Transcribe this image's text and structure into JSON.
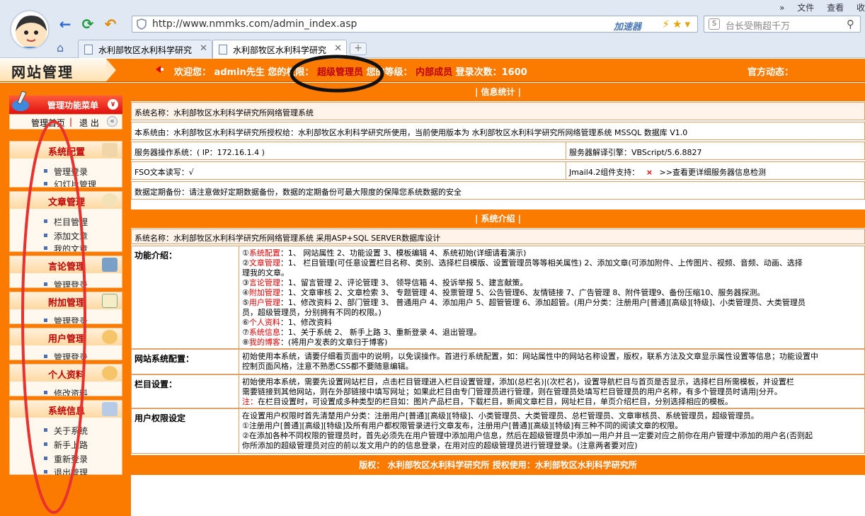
{
  "browser": {
    "toolbar_links": [
      "»",
      "文件",
      "查看",
      "收"
    ],
    "url": "http://www.nmmks.com/admin_index.asp",
    "accelerator": "加速器",
    "search_placeholder": "台长受贿超千万",
    "tabs": [
      "水利部牧区水利科学研究",
      "水利部牧区水利科学研究"
    ],
    "new_tab": "+"
  },
  "header": {
    "site_title": "网站管理",
    "welcome_prefix": "欢迎您：",
    "user": "admin先生",
    "perm_label": "您的权限：",
    "perm_value": "超级管理员",
    "level_label": "您的等级：",
    "level_value": "内部成员",
    "login_label": "登录次数：",
    "login_count": "1600",
    "official": "官方动态："
  },
  "sidebar": {
    "menu_title": "管理功能菜单",
    "home_link": "管理首页",
    "sep": "|",
    "logout_link": "退 出",
    "sections": [
      {
        "title": "系统配置",
        "items": [
          "管理登录",
          "幻灯片管理"
        ]
      },
      {
        "title": "文章管理",
        "items": [
          "栏目管理",
          "添加文章",
          "我的文章"
        ]
      },
      {
        "title": "言论管理",
        "items": [
          "管理登录"
        ]
      },
      {
        "title": "附加管理",
        "items": [
          "管理登录"
        ]
      },
      {
        "title": "用户管理",
        "items": [
          "管理登录"
        ]
      },
      {
        "title": "个人资料",
        "items": [
          "修改资料"
        ]
      },
      {
        "title": "系统信息",
        "items": [
          "关于系统",
          "新手上路",
          "重新登录",
          "退出管理"
        ]
      }
    ]
  },
  "stats": {
    "header": "| 信息统计 |",
    "system_name": "系统名称：水利部牧区水利科学研究所网络管理系统",
    "license": "本系统由：水利部牧区水利科学研究所授权给：水利部牧区水利科学研究所使用，当前使用版本为 水利部牧区水利科学研究所网络管理系统  MSSQL 数据库 V1.0",
    "server_os": "服务器操作系统：( IP：172.16.1.4 )",
    "server_engine": "服务器解译引擎：VBScript/5.6.8827",
    "fso": "FSO文本读写：√",
    "jmail": "Jmail4.2组件支持：",
    "jmail_cross": "×",
    "jmail_link": ">>查看更详细服务器信息检测",
    "backup": "数据定期备份：请注意做好定期数据备份，数据的定期备份可最大限度的保障您系统数据的安全"
  },
  "intro": {
    "header": "| 系统介绍 |",
    "system_name": "系统名称：水利部牧区水利科学研究所网络管理系统 采用ASP+SQL SERVER数据库设计",
    "func_label": "功能介绍：",
    "func_lines": [
      [
        "①",
        "系统配置",
        "：1、 网站属性 2、功能设置 3、模板编辑 4、系统初始(详细请看演示)"
      ],
      [
        "②",
        "文章管理",
        "：1、 栏目管理(可任意设置栏目名称、类别、选择栏目模版、设置管理员等等相关属性) 2、添加文章(可添加附件、上传图片、视频、音频、动画、选择"
      ],
      [
        "",
        "",
        "理我的文章。"
      ],
      [
        "③",
        "言论管理",
        "：1、留言管理 2、评论管理 3、 领导信箱 4、投诉举报 5、建言献策。"
      ],
      [
        "④",
        "附加管理",
        "：1、文章审核 2、文章检索 3、 专题管理 4、投票管理 5、公告管理6、友情链接 7、广告管理 8、附件管理9、备份压缩10、服务器探测。"
      ],
      [
        "⑤",
        "用户管理",
        "：1、修改资料 2、部门管理 3、 普通用户 4、添加用户 5、超管管理 6、添加超管。(用户分类：注册用户[普通][高级][特级]、小类管理员、大类管理员"
      ],
      [
        "",
        "",
        "员，超级管理员，分别拥有不同的权限。)"
      ],
      [
        "⑥",
        "个人资料",
        "：1、修改资料"
      ],
      [
        "⑦",
        "系统信息",
        "：1、关于系统 2、 新手上路 3、重新登录 4、退出管理。"
      ],
      [
        "⑧",
        "我的博客",
        "：(将用户发表的文章归于博客)"
      ]
    ],
    "site_config_label": "网站系统配置：",
    "site_config_lines": [
      "初始使用本系统，请要仔细看页面中的说明，以免误操作。首进行系统配置，如：网站属性中的网站名称设置，版权，联系方法及文章显示属性设置等信息；功能设置中",
      "控制页面风格，注意不熟悉CSS都不要随意编辑。"
    ],
    "column_label": "栏目设置：",
    "column_lines": [
      "初始使用本系统，需要先设置网站栏目，点击栏目管理进入栏目设置管理，添加(总栏名)|(次栏名)，设置导航栏目与首页是否显示，选择栏目所需模板，并设置栏",
      "需要链接到其他网站，则在外部链接中填写网址；如果此栏目由专门管理员进行管理，则在管理员处填写栏目管理员的用户名称，有多个管理员时请用|分开。"
    ],
    "column_note_prefix": "注：",
    "column_note": "在栏目设置时，可设置成多种类型的栏目如：图片产品栏目，下载栏目，新闻文章栏目，网址栏目，单页介绍栏目，分别选择相应的模板。",
    "perm_label": "用户权限设定",
    "perm_lines": [
      "在设置用户权限时首先清楚用户分类：注册用户[普通][高级][特级]、小类管理员、大类管理员、总栏管理员、文章审核员、系统管理员，超级管理员。",
      "①注册用户[普通][高级][特级]及所有用户都权限管录进行文章发布，注册用户[普通][高级][特级]有三种不同的阅读文章的权限。",
      "②在添加各种不同权限的管理员时，首先必须先在用户管理中添加用户信息，然后在超级管理员中添加一用户并且一定要对应之前你在用户管理中添加的用户名(否则起",
      "你所添加的超级管理员对应的前以发文用户的的信息登录，在用对应的超级管理员进行管理登录。(注意两者要对应)"
    ]
  },
  "footer": {
    "copyright_label": "版权：",
    "copyright_value": "水利部牧区水利科学研究所",
    "license_label": "授权使用：",
    "license_value": "水利部牧区水利科学研究所"
  },
  "colors": {
    "accent": "#fb7a00",
    "highlight": "#e00000",
    "annotation": "#e8322e"
  }
}
